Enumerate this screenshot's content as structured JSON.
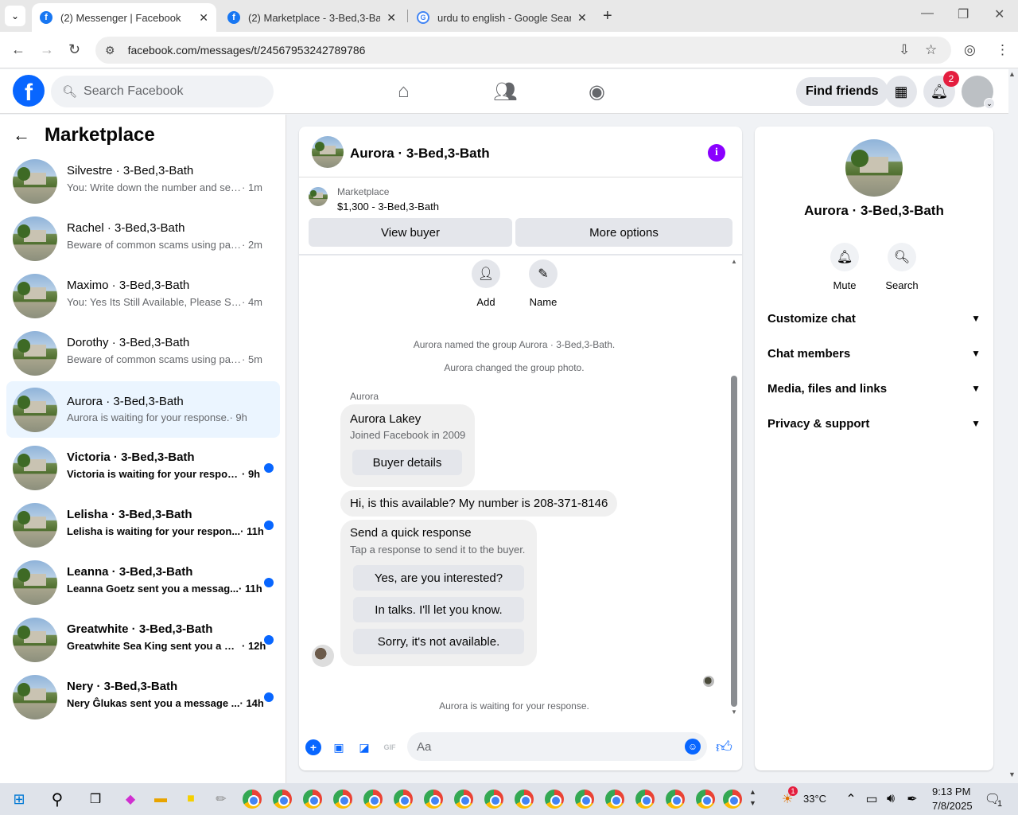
{
  "browser": {
    "tabs": [
      {
        "title": "(2) Messenger | Facebook",
        "icon": "facebook-icon",
        "active": true
      },
      {
        "title": "(2) Marketplace - 3-Bed,3-Bath",
        "icon": "facebook-icon",
        "active": false
      },
      {
        "title": "urdu to english - Google Search",
        "icon": "google-icon",
        "active": false
      }
    ],
    "url": "facebook.com/messages/t/24567953242789786"
  },
  "fb": {
    "search_placeholder": "Search Facebook",
    "find_friends": "Find friends",
    "notification_count": "2"
  },
  "sidebar": {
    "title": "Marketplace",
    "conversations": [
      {
        "name": "Silvestre · 3-Bed,3-Bath",
        "snippet": "You: Write down the number and sen...",
        "time": "· 1m",
        "unread": false,
        "active": false
      },
      {
        "name": "Rachel · 3-Bed,3-Bath",
        "snippet": "Beware of common scams using pay...",
        "time": "· 2m",
        "unread": false,
        "active": false
      },
      {
        "name": "Maximo · 3-Bed,3-Bath",
        "snippet": "You: Yes Its Still Available, Please Sen...",
        "time": "· 4m",
        "unread": false,
        "active": false
      },
      {
        "name": "Dorothy · 3-Bed,3-Bath",
        "snippet": "Beware of common scams using pay...",
        "time": "· 5m",
        "unread": false,
        "active": false
      },
      {
        "name": "Aurora · 3-Bed,3-Bath",
        "snippet": "Aurora is waiting for your response.",
        "time": "· 9h",
        "unread": false,
        "active": true
      },
      {
        "name": "Victoria · 3-Bed,3-Bath",
        "snippet": "Victoria is waiting for your respon...",
        "time": "· 9h",
        "unread": true,
        "active": false
      },
      {
        "name": "Lelisha · 3-Bed,3-Bath",
        "snippet": "Lelisha is waiting for your respon...",
        "time": "· 11h",
        "unread": true,
        "active": false
      },
      {
        "name": "Leanna · 3-Bed,3-Bath",
        "snippet": "Leanna Goetz sent you a messag...",
        "time": "· 11h",
        "unread": true,
        "active": false
      },
      {
        "name": "Greatwhite · 3-Bed,3-Bath",
        "snippet": "Greatwhite Sea King sent you a m...",
        "time": "· 12h",
        "unread": true,
        "active": false
      },
      {
        "name": "Nery · 3-Bed,3-Bath",
        "snippet": "Nery Ĝlukas sent you a message ...",
        "time": "· 14h",
        "unread": true,
        "active": false
      }
    ]
  },
  "chat": {
    "title": "Aurora · 3-Bed,3-Bath",
    "listing_label": "Marketplace",
    "listing_price": "$1,300 - 3-Bed,3-Bath",
    "view_buyer": "View buyer",
    "more_options": "More options",
    "add_label": "Add",
    "name_label": "Name",
    "sys1": "Aurora named the group Aurora · 3-Bed,3-Bath.",
    "sys2": "Aurora changed the group photo.",
    "sender": "Aurora",
    "profile_name": "Aurora Lakey",
    "profile_joined": "Joined Facebook in 2009",
    "buyer_details": "Buyer details",
    "message": "Hi, is this available? My number is 208-371-8146",
    "quick_title": "Send a quick response",
    "quick_sub": "Tap a response to send it to the buyer.",
    "quick_responses": [
      "Yes, are you interested?",
      "In talks. I'll let you know.",
      "Sorry, it's not available."
    ],
    "waiting": "Aurora is waiting for your response.",
    "composer_placeholder": "Aa"
  },
  "info": {
    "title": "Aurora · 3-Bed,3-Bath",
    "mute": "Mute",
    "search": "Search",
    "sections": [
      "Customize chat",
      "Chat members",
      "Media, files and links",
      "Privacy & support"
    ]
  },
  "taskbar": {
    "temperature": "33°C",
    "time": "9:13 PM",
    "date": "7/8/2025",
    "notif_count": "1",
    "weather_badge": "1"
  },
  "colors": {
    "fb_blue": "#0866ff",
    "unread_dot": "#0866ff",
    "info_purple": "#8a00ff",
    "badge_red": "#e41e3f",
    "active_row": "#ebf5ff"
  }
}
